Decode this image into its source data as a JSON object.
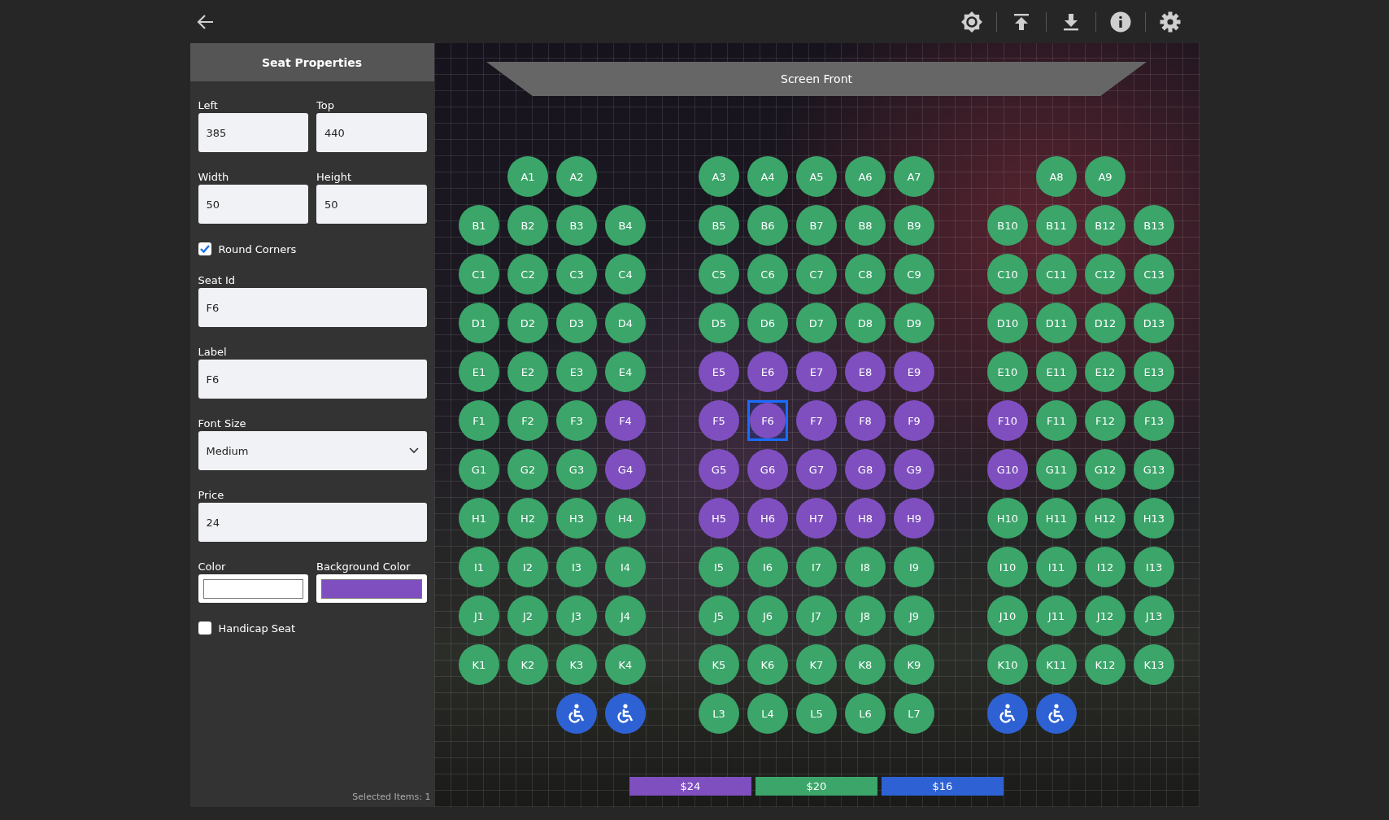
{
  "panel": {
    "title": "Seat Properties",
    "rows": [
      [
        {
          "kind": "text",
          "label": "Left",
          "value": "385"
        },
        {
          "kind": "text",
          "label": "Top",
          "value": "440"
        }
      ],
      [
        {
          "kind": "text",
          "label": "Width",
          "value": "50"
        },
        {
          "kind": "text",
          "label": "Height",
          "value": "50"
        }
      ],
      [
        {
          "kind": "checkbox",
          "label": "Round Corners",
          "checked": true
        }
      ],
      [
        {
          "kind": "text",
          "label": "Seat Id",
          "value": "F6"
        }
      ],
      [
        {
          "kind": "text",
          "label": "Label",
          "value": "F6"
        }
      ],
      [
        {
          "kind": "select",
          "label": "Font Size",
          "value": "Medium"
        }
      ],
      [
        {
          "kind": "text",
          "label": "Price",
          "value": "24"
        }
      ],
      [
        {
          "kind": "color",
          "label": "Color",
          "color": "#ffffff"
        },
        {
          "kind": "color",
          "label": "Background Color",
          "color": "#7f4fc0"
        }
      ],
      [
        {
          "kind": "checkbox",
          "label": "Handicap Seat",
          "checked": false
        }
      ]
    ],
    "status": "Selected Items: 1"
  },
  "seat_map": {
    "screen_label": "Screen Front",
    "rows": [
      [
        [
          null,
          {
            "kind": "seat",
            "label": "A1",
            "color": "#3ba56a",
            "selected": false
          },
          {
            "kind": "seat",
            "label": "A2",
            "color": "#3ba56a",
            "selected": false
          },
          null
        ],
        [
          {
            "kind": "seat",
            "label": "A3",
            "color": "#3ba56a",
            "selected": false
          },
          {
            "kind": "seat",
            "label": "A4",
            "color": "#3ba56a",
            "selected": false
          },
          {
            "kind": "seat",
            "label": "A5",
            "color": "#3ba56a",
            "selected": false
          },
          {
            "kind": "seat",
            "label": "A6",
            "color": "#3ba56a",
            "selected": false
          },
          {
            "kind": "seat",
            "label": "A7",
            "color": "#3ba56a",
            "selected": false
          }
        ],
        [
          null,
          {
            "kind": "seat",
            "label": "A8",
            "color": "#3ba56a",
            "selected": false
          },
          {
            "kind": "seat",
            "label": "A9",
            "color": "#3ba56a",
            "selected": false
          },
          null
        ]
      ],
      [
        [
          {
            "kind": "seat",
            "label": "B1",
            "color": "#3ba56a",
            "selected": false
          },
          {
            "kind": "seat",
            "label": "B2",
            "color": "#3ba56a",
            "selected": false
          },
          {
            "kind": "seat",
            "label": "B3",
            "color": "#3ba56a",
            "selected": false
          },
          {
            "kind": "seat",
            "label": "B4",
            "color": "#3ba56a",
            "selected": false
          }
        ],
        [
          {
            "kind": "seat",
            "label": "B5",
            "color": "#3ba56a",
            "selected": false
          },
          {
            "kind": "seat",
            "label": "B6",
            "color": "#3ba56a",
            "selected": false
          },
          {
            "kind": "seat",
            "label": "B7",
            "color": "#3ba56a",
            "selected": false
          },
          {
            "kind": "seat",
            "label": "B8",
            "color": "#3ba56a",
            "selected": false
          },
          {
            "kind": "seat",
            "label": "B9",
            "color": "#3ba56a",
            "selected": false
          }
        ],
        [
          {
            "kind": "seat",
            "label": "B10",
            "color": "#3ba56a",
            "selected": false
          },
          {
            "kind": "seat",
            "label": "B11",
            "color": "#3ba56a",
            "selected": false
          },
          {
            "kind": "seat",
            "label": "B12",
            "color": "#3ba56a",
            "selected": false
          },
          {
            "kind": "seat",
            "label": "B13",
            "color": "#3ba56a",
            "selected": false
          }
        ]
      ],
      [
        [
          {
            "kind": "seat",
            "label": "C1",
            "color": "#3ba56a",
            "selected": false
          },
          {
            "kind": "seat",
            "label": "C2",
            "color": "#3ba56a",
            "selected": false
          },
          {
            "kind": "seat",
            "label": "C3",
            "color": "#3ba56a",
            "selected": false
          },
          {
            "kind": "seat",
            "label": "C4",
            "color": "#3ba56a",
            "selected": false
          }
        ],
        [
          {
            "kind": "seat",
            "label": "C5",
            "color": "#3ba56a",
            "selected": false
          },
          {
            "kind": "seat",
            "label": "C6",
            "color": "#3ba56a",
            "selected": false
          },
          {
            "kind": "seat",
            "label": "C7",
            "color": "#3ba56a",
            "selected": false
          },
          {
            "kind": "seat",
            "label": "C8",
            "color": "#3ba56a",
            "selected": false
          },
          {
            "kind": "seat",
            "label": "C9",
            "color": "#3ba56a",
            "selected": false
          }
        ],
        [
          {
            "kind": "seat",
            "label": "C10",
            "color": "#3ba56a",
            "selected": false
          },
          {
            "kind": "seat",
            "label": "C11",
            "color": "#3ba56a",
            "selected": false
          },
          {
            "kind": "seat",
            "label": "C12",
            "color": "#3ba56a",
            "selected": false
          },
          {
            "kind": "seat",
            "label": "C13",
            "color": "#3ba56a",
            "selected": false
          }
        ]
      ],
      [
        [
          {
            "kind": "seat",
            "label": "D1",
            "color": "#3ba56a",
            "selected": false
          },
          {
            "kind": "seat",
            "label": "D2",
            "color": "#3ba56a",
            "selected": false
          },
          {
            "kind": "seat",
            "label": "D3",
            "color": "#3ba56a",
            "selected": false
          },
          {
            "kind": "seat",
            "label": "D4",
            "color": "#3ba56a",
            "selected": false
          }
        ],
        [
          {
            "kind": "seat",
            "label": "D5",
            "color": "#3ba56a",
            "selected": false
          },
          {
            "kind": "seat",
            "label": "D6",
            "color": "#3ba56a",
            "selected": false
          },
          {
            "kind": "seat",
            "label": "D7",
            "color": "#3ba56a",
            "selected": false
          },
          {
            "kind": "seat",
            "label": "D8",
            "color": "#3ba56a",
            "selected": false
          },
          {
            "kind": "seat",
            "label": "D9",
            "color": "#3ba56a",
            "selected": false
          }
        ],
        [
          {
            "kind": "seat",
            "label": "D10",
            "color": "#3ba56a",
            "selected": false
          },
          {
            "kind": "seat",
            "label": "D11",
            "color": "#3ba56a",
            "selected": false
          },
          {
            "kind": "seat",
            "label": "D12",
            "color": "#3ba56a",
            "selected": false
          },
          {
            "kind": "seat",
            "label": "D13",
            "color": "#3ba56a",
            "selected": false
          }
        ]
      ],
      [
        [
          {
            "kind": "seat",
            "label": "E1",
            "color": "#3ba56a",
            "selected": false
          },
          {
            "kind": "seat",
            "label": "E2",
            "color": "#3ba56a",
            "selected": false
          },
          {
            "kind": "seat",
            "label": "E3",
            "color": "#3ba56a",
            "selected": false
          },
          {
            "kind": "seat",
            "label": "E4",
            "color": "#3ba56a",
            "selected": false
          }
        ],
        [
          {
            "kind": "seat",
            "label": "E5",
            "color": "#7f4fc0",
            "selected": false
          },
          {
            "kind": "seat",
            "label": "E6",
            "color": "#7f4fc0",
            "selected": false
          },
          {
            "kind": "seat",
            "label": "E7",
            "color": "#7f4fc0",
            "selected": false
          },
          {
            "kind": "seat",
            "label": "E8",
            "color": "#7f4fc0",
            "selected": false
          },
          {
            "kind": "seat",
            "label": "E9",
            "color": "#7f4fc0",
            "selected": false
          }
        ],
        [
          {
            "kind": "seat",
            "label": "E10",
            "color": "#3ba56a",
            "selected": false
          },
          {
            "kind": "seat",
            "label": "E11",
            "color": "#3ba56a",
            "selected": false
          },
          {
            "kind": "seat",
            "label": "E12",
            "color": "#3ba56a",
            "selected": false
          },
          {
            "kind": "seat",
            "label": "E13",
            "color": "#3ba56a",
            "selected": false
          }
        ]
      ],
      [
        [
          {
            "kind": "seat",
            "label": "F1",
            "color": "#3ba56a",
            "selected": false
          },
          {
            "kind": "seat",
            "label": "F2",
            "color": "#3ba56a",
            "selected": false
          },
          {
            "kind": "seat",
            "label": "F3",
            "color": "#3ba56a",
            "selected": false
          },
          {
            "kind": "seat",
            "label": "F4",
            "color": "#7f4fc0",
            "selected": false
          }
        ],
        [
          {
            "kind": "seat",
            "label": "F5",
            "color": "#7f4fc0",
            "selected": false
          },
          {
            "kind": "seat",
            "label": "F6",
            "color": "#7f4fc0",
            "selected": true
          },
          {
            "kind": "seat",
            "label": "F7",
            "color": "#7f4fc0",
            "selected": false
          },
          {
            "kind": "seat",
            "label": "F8",
            "color": "#7f4fc0",
            "selected": false
          },
          {
            "kind": "seat",
            "label": "F9",
            "color": "#7f4fc0",
            "selected": false
          }
        ],
        [
          {
            "kind": "seat",
            "label": "F10",
            "color": "#7f4fc0",
            "selected": false
          },
          {
            "kind": "seat",
            "label": "F11",
            "color": "#3ba56a",
            "selected": false
          },
          {
            "kind": "seat",
            "label": "F12",
            "color": "#3ba56a",
            "selected": false
          },
          {
            "kind": "seat",
            "label": "F13",
            "color": "#3ba56a",
            "selected": false
          }
        ]
      ],
      [
        [
          {
            "kind": "seat",
            "label": "G1",
            "color": "#3ba56a",
            "selected": false
          },
          {
            "kind": "seat",
            "label": "G2",
            "color": "#3ba56a",
            "selected": false
          },
          {
            "kind": "seat",
            "label": "G3",
            "color": "#3ba56a",
            "selected": false
          },
          {
            "kind": "seat",
            "label": "G4",
            "color": "#7f4fc0",
            "selected": false
          }
        ],
        [
          {
            "kind": "seat",
            "label": "G5",
            "color": "#7f4fc0",
            "selected": false
          },
          {
            "kind": "seat",
            "label": "G6",
            "color": "#7f4fc0",
            "selected": false
          },
          {
            "kind": "seat",
            "label": "G7",
            "color": "#7f4fc0",
            "selected": false
          },
          {
            "kind": "seat",
            "label": "G8",
            "color": "#7f4fc0",
            "selected": false
          },
          {
            "kind": "seat",
            "label": "G9",
            "color": "#7f4fc0",
            "selected": false
          }
        ],
        [
          {
            "kind": "seat",
            "label": "G10",
            "color": "#7f4fc0",
            "selected": false
          },
          {
            "kind": "seat",
            "label": "G11",
            "color": "#3ba56a",
            "selected": false
          },
          {
            "kind": "seat",
            "label": "G12",
            "color": "#3ba56a",
            "selected": false
          },
          {
            "kind": "seat",
            "label": "G13",
            "color": "#3ba56a",
            "selected": false
          }
        ]
      ],
      [
        [
          {
            "kind": "seat",
            "label": "H1",
            "color": "#3ba56a",
            "selected": false
          },
          {
            "kind": "seat",
            "label": "H2",
            "color": "#3ba56a",
            "selected": false
          },
          {
            "kind": "seat",
            "label": "H3",
            "color": "#3ba56a",
            "selected": false
          },
          {
            "kind": "seat",
            "label": "H4",
            "color": "#3ba56a",
            "selected": false
          }
        ],
        [
          {
            "kind": "seat",
            "label": "H5",
            "color": "#7f4fc0",
            "selected": false
          },
          {
            "kind": "seat",
            "label": "H6",
            "color": "#7f4fc0",
            "selected": false
          },
          {
            "kind": "seat",
            "label": "H7",
            "color": "#7f4fc0",
            "selected": false
          },
          {
            "kind": "seat",
            "label": "H8",
            "color": "#7f4fc0",
            "selected": false
          },
          {
            "kind": "seat",
            "label": "H9",
            "color": "#7f4fc0",
            "selected": false
          }
        ],
        [
          {
            "kind": "seat",
            "label": "H10",
            "color": "#3ba56a",
            "selected": false
          },
          {
            "kind": "seat",
            "label": "H11",
            "color": "#3ba56a",
            "selected": false
          },
          {
            "kind": "seat",
            "label": "H12",
            "color": "#3ba56a",
            "selected": false
          },
          {
            "kind": "seat",
            "label": "H13",
            "color": "#3ba56a",
            "selected": false
          }
        ]
      ],
      [
        [
          {
            "kind": "seat",
            "label": "I1",
            "color": "#3ba56a",
            "selected": false
          },
          {
            "kind": "seat",
            "label": "I2",
            "color": "#3ba56a",
            "selected": false
          },
          {
            "kind": "seat",
            "label": "I3",
            "color": "#3ba56a",
            "selected": false
          },
          {
            "kind": "seat",
            "label": "I4",
            "color": "#3ba56a",
            "selected": false
          }
        ],
        [
          {
            "kind": "seat",
            "label": "I5",
            "color": "#3ba56a",
            "selected": false
          },
          {
            "kind": "seat",
            "label": "I6",
            "color": "#3ba56a",
            "selected": false
          },
          {
            "kind": "seat",
            "label": "I7",
            "color": "#3ba56a",
            "selected": false
          },
          {
            "kind": "seat",
            "label": "I8",
            "color": "#3ba56a",
            "selected": false
          },
          {
            "kind": "seat",
            "label": "I9",
            "color": "#3ba56a",
            "selected": false
          }
        ],
        [
          {
            "kind": "seat",
            "label": "I10",
            "color": "#3ba56a",
            "selected": false
          },
          {
            "kind": "seat",
            "label": "I11",
            "color": "#3ba56a",
            "selected": false
          },
          {
            "kind": "seat",
            "label": "I12",
            "color": "#3ba56a",
            "selected": false
          },
          {
            "kind": "seat",
            "label": "I13",
            "color": "#3ba56a",
            "selected": false
          }
        ]
      ],
      [
        [
          {
            "kind": "seat",
            "label": "J1",
            "color": "#3ba56a",
            "selected": false
          },
          {
            "kind": "seat",
            "label": "J2",
            "color": "#3ba56a",
            "selected": false
          },
          {
            "kind": "seat",
            "label": "J3",
            "color": "#3ba56a",
            "selected": false
          },
          {
            "kind": "seat",
            "label": "J4",
            "color": "#3ba56a",
            "selected": false
          }
        ],
        [
          {
            "kind": "seat",
            "label": "J5",
            "color": "#3ba56a",
            "selected": false
          },
          {
            "kind": "seat",
            "label": "J6",
            "color": "#3ba56a",
            "selected": false
          },
          {
            "kind": "seat",
            "label": "J7",
            "color": "#3ba56a",
            "selected": false
          },
          {
            "kind": "seat",
            "label": "J8",
            "color": "#3ba56a",
            "selected": false
          },
          {
            "kind": "seat",
            "label": "J9",
            "color": "#3ba56a",
            "selected": false
          }
        ],
        [
          {
            "kind": "seat",
            "label": "J10",
            "color": "#3ba56a",
            "selected": false
          },
          {
            "kind": "seat",
            "label": "J11",
            "color": "#3ba56a",
            "selected": false
          },
          {
            "kind": "seat",
            "label": "J12",
            "color": "#3ba56a",
            "selected": false
          },
          {
            "kind": "seat",
            "label": "J13",
            "color": "#3ba56a",
            "selected": false
          }
        ]
      ],
      [
        [
          {
            "kind": "seat",
            "label": "K1",
            "color": "#3ba56a",
            "selected": false
          },
          {
            "kind": "seat",
            "label": "K2",
            "color": "#3ba56a",
            "selected": false
          },
          {
            "kind": "seat",
            "label": "K3",
            "color": "#3ba56a",
            "selected": false
          },
          {
            "kind": "seat",
            "label": "K4",
            "color": "#3ba56a",
            "selected": false
          }
        ],
        [
          {
            "kind": "seat",
            "label": "K5",
            "color": "#3ba56a",
            "selected": false
          },
          {
            "kind": "seat",
            "label": "K6",
            "color": "#3ba56a",
            "selected": false
          },
          {
            "kind": "seat",
            "label": "K7",
            "color": "#3ba56a",
            "selected": false
          },
          {
            "kind": "seat",
            "label": "K8",
            "color": "#3ba56a",
            "selected": false
          },
          {
            "kind": "seat",
            "label": "K9",
            "color": "#3ba56a",
            "selected": false
          }
        ],
        [
          {
            "kind": "seat",
            "label": "K10",
            "color": "#3ba56a",
            "selected": false
          },
          {
            "kind": "seat",
            "label": "K11",
            "color": "#3ba56a",
            "selected": false
          },
          {
            "kind": "seat",
            "label": "K12",
            "color": "#3ba56a",
            "selected": false
          },
          {
            "kind": "seat",
            "label": "K13",
            "color": "#3ba56a",
            "selected": false
          }
        ]
      ],
      [
        [
          null,
          null,
          {
            "kind": "wheelchair",
            "color": "#2e62d4",
            "selected": false
          },
          {
            "kind": "wheelchair",
            "color": "#2e62d4",
            "selected": false
          }
        ],
        [
          {
            "kind": "seat",
            "label": "L3",
            "color": "#3ba56a",
            "selected": false
          },
          {
            "kind": "seat",
            "label": "L4",
            "color": "#3ba56a",
            "selected": false
          },
          {
            "kind": "seat",
            "label": "L5",
            "color": "#3ba56a",
            "selected": false
          },
          {
            "kind": "seat",
            "label": "L6",
            "color": "#3ba56a",
            "selected": false
          },
          {
            "kind": "seat",
            "label": "L7",
            "color": "#3ba56a",
            "selected": false
          }
        ],
        [
          {
            "kind": "wheelchair",
            "color": "#2e62d4",
            "selected": false
          },
          {
            "kind": "wheelchair",
            "color": "#2e62d4",
            "selected": false
          },
          null,
          null
        ]
      ]
    ],
    "legend": [
      {
        "label": "$24",
        "color": "#7f4fc0"
      },
      {
        "label": "$20",
        "color": "#3ba56a"
      },
      {
        "label": "$16",
        "color": "#2e62d4"
      }
    ]
  }
}
